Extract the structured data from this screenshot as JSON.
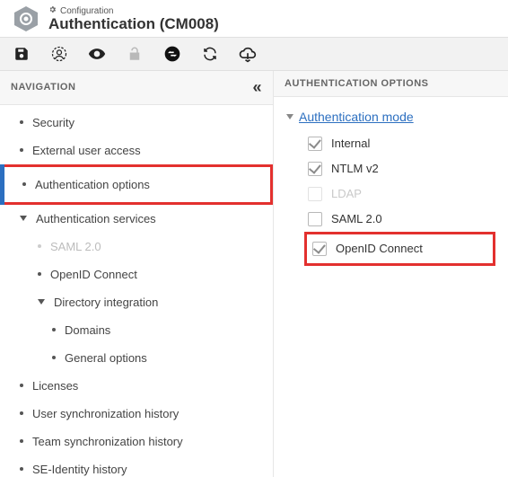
{
  "header": {
    "eyebrow": "Configuration",
    "title": "Authentication (CM008)"
  },
  "toolbar": {
    "save": "Save",
    "profiles": "Profiles",
    "show": "Show",
    "unlock": "Unlock",
    "swap": "Transfer",
    "refresh": "Refresh",
    "cloud": "Cloud"
  },
  "panels": {
    "nav_title": "NAVIGATION",
    "opts_title": "AUTHENTICATION OPTIONS"
  },
  "nav": [
    {
      "label": "Security",
      "type": "item",
      "indent": 0
    },
    {
      "label": "External user access",
      "type": "item",
      "indent": 0
    },
    {
      "label": "Authentication options",
      "type": "item",
      "indent": 0,
      "highlight": true
    },
    {
      "label": "Authentication services",
      "type": "group",
      "indent": 0
    },
    {
      "label": "SAML 2.0",
      "type": "item",
      "indent": 1,
      "muted": true
    },
    {
      "label": "OpenID Connect",
      "type": "item",
      "indent": 1
    },
    {
      "label": "Directory integration",
      "type": "group",
      "indent": 1
    },
    {
      "label": "Domains",
      "type": "item",
      "indent": 2
    },
    {
      "label": "General options",
      "type": "item",
      "indent": 2
    },
    {
      "label": "Licenses",
      "type": "item",
      "indent": 0
    },
    {
      "label": "User synchronization history",
      "type": "item",
      "indent": 0
    },
    {
      "label": "Team synchronization history",
      "type": "item",
      "indent": 0
    },
    {
      "label": "SE-Identity history",
      "type": "item",
      "indent": 0
    }
  ],
  "auth_group": {
    "title": "Authentication mode",
    "options": [
      {
        "label": "Internal",
        "checked": true,
        "disabled": false
      },
      {
        "label": "NTLM v2",
        "checked": true,
        "disabled": false
      },
      {
        "label": "LDAP",
        "checked": false,
        "disabled": true
      },
      {
        "label": "SAML 2.0",
        "checked": false,
        "disabled": false
      },
      {
        "label": "OpenID Connect",
        "checked": true,
        "disabled": false,
        "highlight": true
      }
    ]
  }
}
